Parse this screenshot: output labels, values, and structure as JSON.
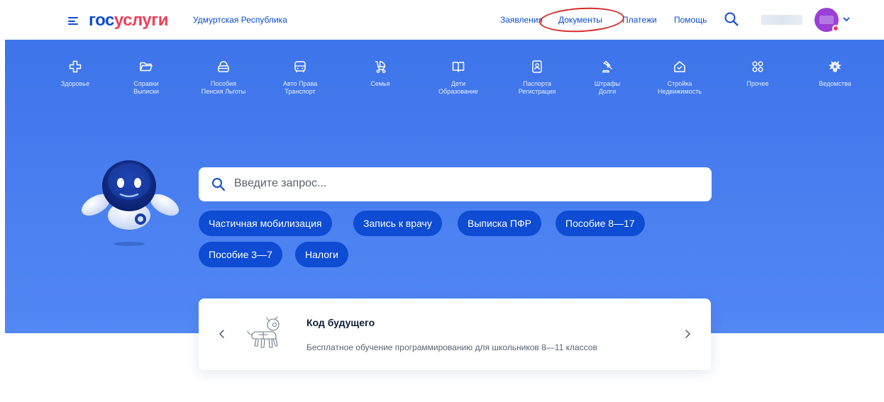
{
  "header": {
    "logo_part1": "гос",
    "logo_part2": "услуги",
    "region": "Удмуртская Республика",
    "nav": [
      "Заявления",
      "Документы",
      "Платежи",
      "Помощь"
    ]
  },
  "categories": [
    {
      "line1": "Здоровье",
      "line2": "",
      "icon": "health-cross-icon"
    },
    {
      "line1": "Справки",
      "line2": "Выписки",
      "icon": "folder-icon"
    },
    {
      "line1": "Пособия",
      "line2": "Пенсия Льготы",
      "icon": "purse-icon"
    },
    {
      "line1": "Авто Права",
      "line2": "Транспорт",
      "icon": "car-icon"
    },
    {
      "line1": "Семья",
      "line2": "",
      "icon": "stroller-icon"
    },
    {
      "line1": "Дети",
      "line2": "Образование",
      "icon": "book-icon"
    },
    {
      "line1": "Паспорта",
      "line2": "Регистрация",
      "icon": "passport-icon"
    },
    {
      "line1": "Штрафы",
      "line2": "Долги",
      "icon": "gavel-icon"
    },
    {
      "line1": "Стройка",
      "line2": "Недвижимость",
      "icon": "house-icon"
    },
    {
      "line1": "Прочее",
      "line2": "",
      "icon": "grid-icon"
    },
    {
      "line1": "Ведомства",
      "line2": "",
      "icon": "coat-of-arms-icon"
    }
  ],
  "search": {
    "placeholder": "Введите запрос..."
  },
  "chips": [
    "Частичная мобилизация",
    "Запись к врачу",
    "Выписка ПФР",
    "Пособие 8—17",
    "Пособие 3—7",
    "Налоги"
  ],
  "promo": {
    "title": "Код будущего",
    "description": "Бесплатное обучение программированию для школьников 8—11 классов"
  },
  "colors": {
    "brand_blue": "#0d4cd3",
    "brand_red": "#ee3f58",
    "hero_blue": "#4a7ff0",
    "annotation_red": "#d62a2a"
  }
}
